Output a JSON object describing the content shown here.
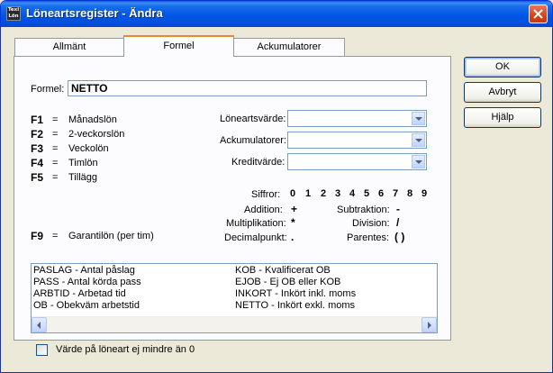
{
  "window": {
    "title": "Löneartsregister - Ändra",
    "icon_text_top": "Texi",
    "icon_text_bottom": "Lön"
  },
  "tabs": [
    {
      "label": "Allmänt",
      "active": false
    },
    {
      "label": "Formel",
      "active": true
    },
    {
      "label": "Ackumulatorer",
      "active": false
    }
  ],
  "formel": {
    "label": "Formel:",
    "value": "NETTO"
  },
  "function_keys": [
    {
      "key": "F1",
      "eq": "=",
      "desc": "Månadslön"
    },
    {
      "key": "F2",
      "eq": "=",
      "desc": "2-veckorslön"
    },
    {
      "key": "F3",
      "eq": "=",
      "desc": "Veckolön"
    },
    {
      "key": "F4",
      "eq": "=",
      "desc": "Timlön"
    },
    {
      "key": "F5",
      "eq": "=",
      "desc": "Tillägg"
    },
    {
      "key": "F9",
      "eq": "=",
      "desc": "Garantilön (per tim)"
    }
  ],
  "combos": [
    {
      "label": "Löneartsvärde:",
      "value": ""
    },
    {
      "label": "Ackumulatorer:",
      "value": ""
    },
    {
      "label": "Kreditvärde:",
      "value": ""
    }
  ],
  "operators": {
    "siffror_label": "Siffror:",
    "digits": [
      "0",
      "1",
      "2",
      "3",
      "4",
      "5",
      "6",
      "7",
      "8",
      "9"
    ],
    "addition_label": "Addition:",
    "addition_symbol": "+",
    "subtraktion_label": "Subtraktion:",
    "subtraktion_symbol": "-",
    "multiplikation_label": "Multiplikation:",
    "multiplikation_symbol": "*",
    "division_label": "Division:",
    "division_symbol": "/",
    "decimalpunkt_label": "Decimalpunkt:",
    "decimalpunkt_symbol": ".",
    "parentes_label": "Parentes:",
    "parentes_symbol": "( )"
  },
  "variables": {
    "left": [
      "PASLAG - Antal påslag",
      "PASS - Antal körda pass",
      "ARBTID - Arbetad tid",
      "OB - Obekväm arbetstid"
    ],
    "right": [
      "KOB - Kvalificerat OB",
      "EJOB - Ej OB eller KOB",
      "INKORT - Inkört inkl. moms",
      "NETTO - Inkört exkl. moms"
    ]
  },
  "checkbox": {
    "label": "Värde på löneart ej mindre än 0",
    "checked": false
  },
  "buttons": {
    "ok": "OK",
    "avbryt": "Avbryt",
    "hjalp": "Hjälp"
  }
}
